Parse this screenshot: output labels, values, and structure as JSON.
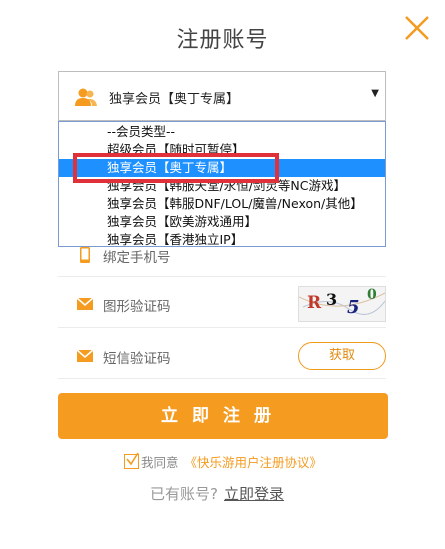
{
  "title": "注册账号",
  "select": {
    "selected": "独享会员【奥丁专属】",
    "icon": "user-group-icon",
    "options": [
      "--会员类型--",
      "超级会员【随时可暂停】",
      "独享会员【奥丁专属】",
      "独享会员【韩服天堂/永恒/剑灵等NC游戏】",
      "独享会员【韩服DNF/LOL/魔兽/Nexon/其他】",
      "独享会员【欧美游戏通用】",
      "独享会员【香港独立IP】"
    ],
    "highlighted_index": 2
  },
  "phone": {
    "label": "绑定手机号",
    "icon": "phone-icon"
  },
  "image_code": {
    "label": "图形验证码",
    "icon": "mail-icon",
    "captcha": [
      "R",
      "3",
      "5",
      "0"
    ]
  },
  "sms_code": {
    "label": "短信验证码",
    "icon": "mail-icon",
    "get_label": "获取"
  },
  "submit_label": "立即注册",
  "agreement": {
    "prefix": "我同意",
    "link": "《快乐游用户注册协议》"
  },
  "login": {
    "prompt": "已有账号?",
    "link": "立即登录"
  },
  "colors": {
    "accent": "#f59b1f",
    "highlight": "#1e90ff",
    "redbox": "#e0303a"
  }
}
